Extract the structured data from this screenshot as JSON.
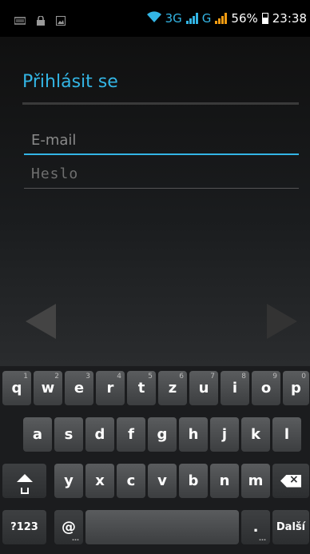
{
  "status_bar": {
    "network_3g": "3G",
    "network_g": "G",
    "battery": "56%",
    "time": "23:38",
    "left_icons": [
      "voicemail-icon",
      "lock-icon",
      "image-icon"
    ]
  },
  "login": {
    "title": "Přihlásit se",
    "email_placeholder": "E-mail",
    "password_placeholder": "Heslo"
  },
  "keyboard": {
    "row1": [
      {
        "label": "q",
        "hint": "1"
      },
      {
        "label": "w",
        "hint": "2"
      },
      {
        "label": "e",
        "hint": "3"
      },
      {
        "label": "r",
        "hint": "4"
      },
      {
        "label": "t",
        "hint": "5"
      },
      {
        "label": "z",
        "hint": "6"
      },
      {
        "label": "u",
        "hint": "7"
      },
      {
        "label": "i",
        "hint": "8"
      },
      {
        "label": "o",
        "hint": "9"
      },
      {
        "label": "p",
        "hint": "0"
      }
    ],
    "row2": [
      "a",
      "s",
      "d",
      "f",
      "g",
      "h",
      "j",
      "k",
      "l"
    ],
    "row3": [
      "y",
      "x",
      "c",
      "v",
      "b",
      "n",
      "m"
    ],
    "symbols_label": "?123",
    "at_label": "@",
    "period_label": ".",
    "next_label": "Další"
  },
  "colors": {
    "accent": "#33b5e5",
    "signal_orange": "#f39c12"
  }
}
